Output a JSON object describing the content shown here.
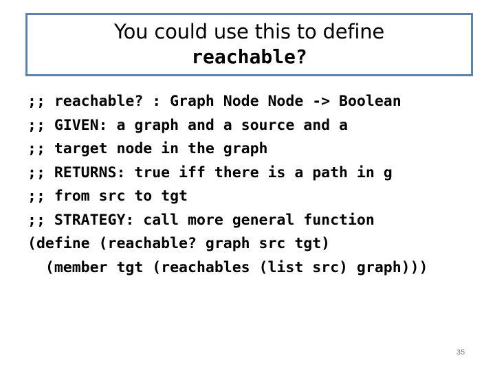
{
  "slide": {
    "background_color": "#ffffff",
    "page_number": "35"
  },
  "title": {
    "border_color": "#5b82ac",
    "line_1": "You could use this to define",
    "line_2": "reachable?"
  },
  "code": {
    "language": "racket",
    "lines": [
      ";; reachable? : Graph Node Node -> Boolean",
      ";; GIVEN: a graph and a source and a",
      ";; target node in the graph",
      ";; RETURNS: true iff there is a path in g",
      ";; from src to tgt",
      ";; STRATEGY: call more general function",
      "(define (reachable? graph src tgt)",
      "  (member tgt (reachables (list src) graph)))"
    ]
  }
}
